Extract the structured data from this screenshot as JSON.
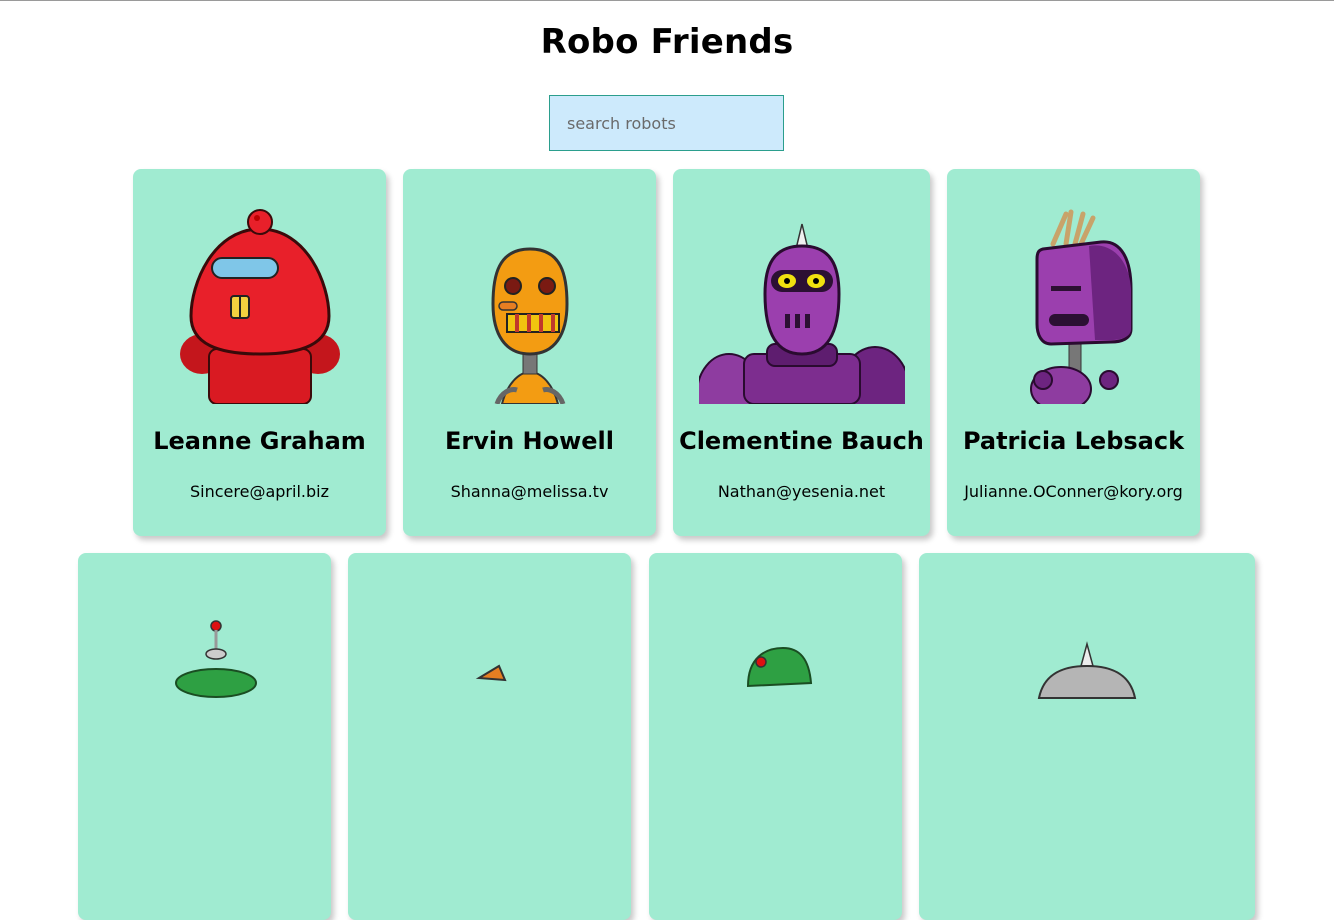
{
  "app": {
    "title": "Robo Friends"
  },
  "search": {
    "placeholder": "search robots",
    "value": ""
  },
  "robots": [
    {
      "name": "Leanne Graham",
      "email": "Sincere@april.biz",
      "icon": "red-robot-avatar"
    },
    {
      "name": "Ervin Howell",
      "email": "Shanna@melissa.tv",
      "icon": "orange-robot-avatar"
    },
    {
      "name": "Clementine Bauch",
      "email": "Nathan@yesenia.net",
      "icon": "purple-robot-avatar"
    },
    {
      "name": "Patricia Lebsack",
      "email": "Julianne.OConner@kory.org",
      "icon": "purple-robot-avatar"
    },
    {
      "name": "",
      "email": "",
      "icon": "green-robot-avatar"
    },
    {
      "name": "",
      "email": "",
      "icon": "orange-robot-avatar"
    },
    {
      "name": "",
      "email": "",
      "icon": "green-robot-avatar"
    },
    {
      "name": "",
      "email": "",
      "icon": "gray-robot-avatar"
    }
  ],
  "colors": {
    "card_background": "#a0ebd1",
    "search_background": "#cdeafc",
    "search_border": "#2b9e8d"
  }
}
